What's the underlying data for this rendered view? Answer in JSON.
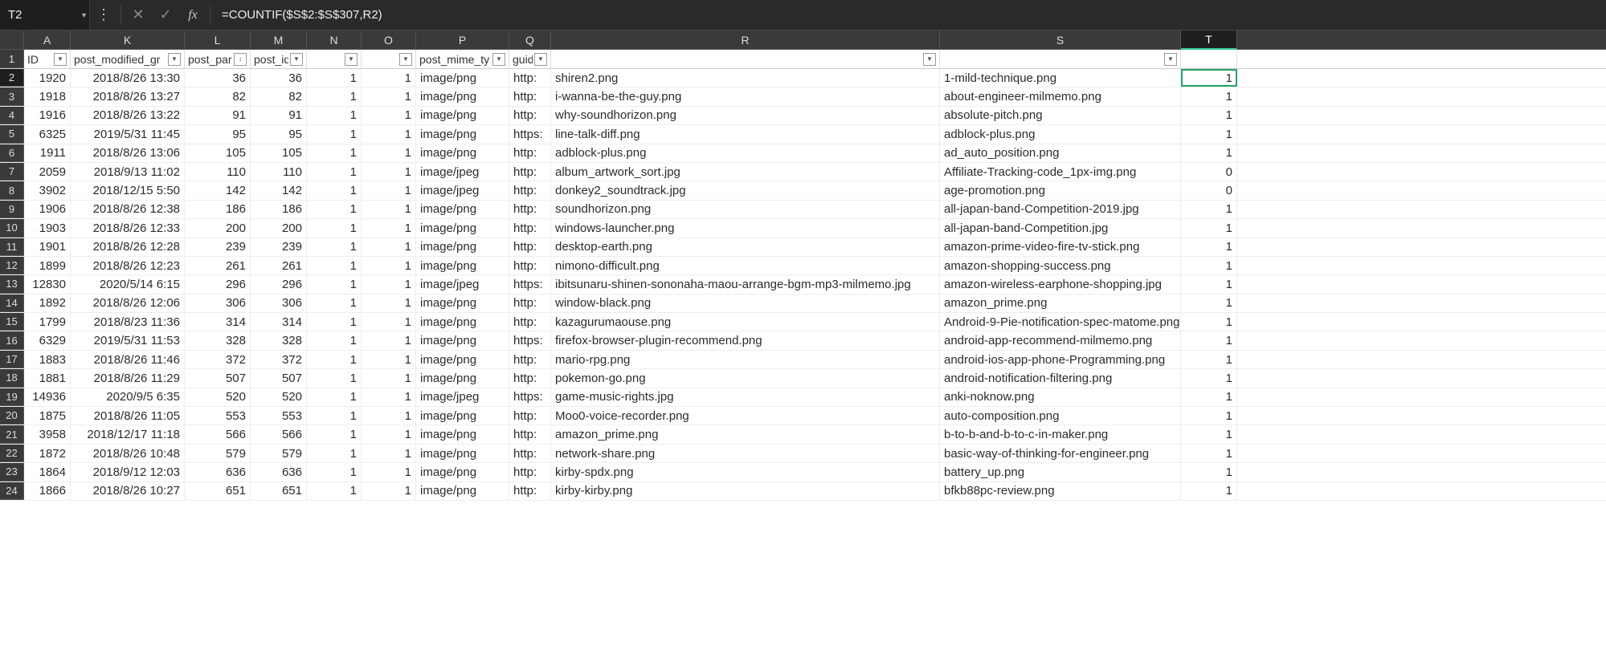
{
  "formula_bar": {
    "cell_ref": "T2",
    "formula": "=COUNTIF($S$2:$S$307,R2)"
  },
  "columns": [
    {
      "letter": "A",
      "width": "cA",
      "header": "ID",
      "filter": "dd"
    },
    {
      "letter": "K",
      "width": "cK",
      "header": "post_modified_gr",
      "filter": "dd"
    },
    {
      "letter": "L",
      "width": "cL",
      "header": "post_pare",
      "filter": "sort"
    },
    {
      "letter": "M",
      "width": "cM",
      "header": "post_id",
      "filter": "dd"
    },
    {
      "letter": "N",
      "width": "cN",
      "header": "",
      "filter": "dd"
    },
    {
      "letter": "O",
      "width": "cO",
      "header": "",
      "filter": "dd"
    },
    {
      "letter": "P",
      "width": "cP",
      "header": "post_mime_ty",
      "filter": "dd"
    },
    {
      "letter": "Q",
      "width": "cQ",
      "header": "guid",
      "filter": "dd"
    },
    {
      "letter": "R",
      "width": "cR",
      "header": "",
      "filter": "dd"
    },
    {
      "letter": "S",
      "width": "cS",
      "header": "",
      "filter": "dd"
    },
    {
      "letter": "T",
      "width": "cT",
      "header": "",
      "filter": null,
      "active": true
    }
  ],
  "rows": [
    {
      "n": 2,
      "A": 1920,
      "K": "2018/8/26 13:30",
      "L": 36,
      "M": 36,
      "N": 1,
      "O": 1,
      "P": "image/png",
      "Q": "http:",
      "R": "shiren2.png",
      "S": "1-mild-technique.png",
      "T": 1,
      "selected": true
    },
    {
      "n": 3,
      "A": 1918,
      "K": "2018/8/26 13:27",
      "L": 82,
      "M": 82,
      "N": 1,
      "O": 1,
      "P": "image/png",
      "Q": "http:",
      "R": "i-wanna-be-the-guy.png",
      "S": "about-engineer-milmemo.png",
      "T": 1
    },
    {
      "n": 4,
      "A": 1916,
      "K": "2018/8/26 13:22",
      "L": 91,
      "M": 91,
      "N": 1,
      "O": 1,
      "P": "image/png",
      "Q": "http:",
      "R": "why-soundhorizon.png",
      "S": "absolute-pitch.png",
      "T": 1
    },
    {
      "n": 5,
      "A": 6325,
      "K": "2019/5/31 11:45",
      "L": 95,
      "M": 95,
      "N": 1,
      "O": 1,
      "P": "image/png",
      "Q": "https:",
      "R": "line-talk-diff.png",
      "S": "adblock-plus.png",
      "T": 1
    },
    {
      "n": 6,
      "A": 1911,
      "K": "2018/8/26 13:06",
      "L": 105,
      "M": 105,
      "N": 1,
      "O": 1,
      "P": "image/png",
      "Q": "http:",
      "R": "adblock-plus.png",
      "S": "ad_auto_position.png",
      "T": 1
    },
    {
      "n": 7,
      "A": 2059,
      "K": "2018/9/13 11:02",
      "L": 110,
      "M": 110,
      "N": 1,
      "O": 1,
      "P": "image/jpeg",
      "Q": "http:",
      "R": "album_artwork_sort.jpg",
      "S": "Affiliate-Tracking-code_1px-img.png",
      "T": 0
    },
    {
      "n": 8,
      "A": 3902,
      "K": "2018/12/15 5:50",
      "L": 142,
      "M": 142,
      "N": 1,
      "O": 1,
      "P": "image/jpeg",
      "Q": "http:",
      "R": "donkey2_soundtrack.jpg",
      "S": "age-promotion.png",
      "T": 0
    },
    {
      "n": 9,
      "A": 1906,
      "K": "2018/8/26 12:38",
      "L": 186,
      "M": 186,
      "N": 1,
      "O": 1,
      "P": "image/png",
      "Q": "http:",
      "R": "soundhorizon.png",
      "S": "all-japan-band-Competition-2019.jpg",
      "T": 1
    },
    {
      "n": 10,
      "A": 1903,
      "K": "2018/8/26 12:33",
      "L": 200,
      "M": 200,
      "N": 1,
      "O": 1,
      "P": "image/png",
      "Q": "http:",
      "R": "windows-launcher.png",
      "S": "all-japan-band-Competition.jpg",
      "T": 1
    },
    {
      "n": 11,
      "A": 1901,
      "K": "2018/8/26 12:28",
      "L": 239,
      "M": 239,
      "N": 1,
      "O": 1,
      "P": "image/png",
      "Q": "http:",
      "R": "desktop-earth.png",
      "S": "amazon-prime-video-fire-tv-stick.png",
      "T": 1
    },
    {
      "n": 12,
      "A": 1899,
      "K": "2018/8/26 12:23",
      "L": 261,
      "M": 261,
      "N": 1,
      "O": 1,
      "P": "image/png",
      "Q": "http:",
      "R": "nimono-difficult.png",
      "S": "amazon-shopping-success.png",
      "T": 1
    },
    {
      "n": 13,
      "A": 12830,
      "K": "2020/5/14 6:15",
      "L": 296,
      "M": 296,
      "N": 1,
      "O": 1,
      "P": "image/jpeg",
      "Q": "https:",
      "R": "ibitsunaru-shinen-sononaha-maou-arrange-bgm-mp3-milmemo.jpg",
      "S": "amazon-wireless-earphone-shopping.jpg",
      "T": 1
    },
    {
      "n": 14,
      "A": 1892,
      "K": "2018/8/26 12:06",
      "L": 306,
      "M": 306,
      "N": 1,
      "O": 1,
      "P": "image/png",
      "Q": "http:",
      "R": "window-black.png",
      "S": "amazon_prime.png",
      "T": 1
    },
    {
      "n": 15,
      "A": 1799,
      "K": "2018/8/23 11:36",
      "L": 314,
      "M": 314,
      "N": 1,
      "O": 1,
      "P": "image/png",
      "Q": "http:",
      "R": "kazagurumaouse.png",
      "S": "Android-9-Pie-notification-spec-matome.png",
      "T": 1
    },
    {
      "n": 16,
      "A": 6329,
      "K": "2019/5/31 11:53",
      "L": 328,
      "M": 328,
      "N": 1,
      "O": 1,
      "P": "image/png",
      "Q": "https:",
      "R": "firefox-browser-plugin-recommend.png",
      "S": "android-app-recommend-milmemo.png",
      "T": 1
    },
    {
      "n": 17,
      "A": 1883,
      "K": "2018/8/26 11:46",
      "L": 372,
      "M": 372,
      "N": 1,
      "O": 1,
      "P": "image/png",
      "Q": "http:",
      "R": "mario-rpg.png",
      "S": "android-ios-app-phone-Programming.png",
      "T": 1
    },
    {
      "n": 18,
      "A": 1881,
      "K": "2018/8/26 11:29",
      "L": 507,
      "M": 507,
      "N": 1,
      "O": 1,
      "P": "image/png",
      "Q": "http:",
      "R": "pokemon-go.png",
      "S": "android-notification-filtering.png",
      "T": 1
    },
    {
      "n": 19,
      "A": 14936,
      "K": "2020/9/5 6:35",
      "L": 520,
      "M": 520,
      "N": 1,
      "O": 1,
      "P": "image/jpeg",
      "Q": "https:",
      "R": "game-music-rights.jpg",
      "S": "anki-noknow.png",
      "T": 1
    },
    {
      "n": 20,
      "A": 1875,
      "K": "2018/8/26 11:05",
      "L": 553,
      "M": 553,
      "N": 1,
      "O": 1,
      "P": "image/png",
      "Q": "http:",
      "R": "Moo0-voice-recorder.png",
      "S": "auto-composition.png",
      "T": 1
    },
    {
      "n": 21,
      "A": 3958,
      "K": "2018/12/17 11:18",
      "L": 566,
      "M": 566,
      "N": 1,
      "O": 1,
      "P": "image/png",
      "Q": "http:",
      "R": "amazon_prime.png",
      "S": "b-to-b-and-b-to-c-in-maker.png",
      "T": 1
    },
    {
      "n": 22,
      "A": 1872,
      "K": "2018/8/26 10:48",
      "L": 579,
      "M": 579,
      "N": 1,
      "O": 1,
      "P": "image/png",
      "Q": "http:",
      "R": "network-share.png",
      "S": "basic-way-of-thinking-for-engineer.png",
      "T": 1
    },
    {
      "n": 23,
      "A": 1864,
      "K": "2018/9/12 12:03",
      "L": 636,
      "M": 636,
      "N": 1,
      "O": 1,
      "P": "image/png",
      "Q": "http:",
      "R": "kirby-spdx.png",
      "S": "battery_up.png",
      "T": 1
    },
    {
      "n": 24,
      "A": 1866,
      "K": "2018/8/26 10:27",
      "L": 651,
      "M": 651,
      "N": 1,
      "O": 1,
      "P": "image/png",
      "Q": "http:",
      "R": "kirby-kirby.png",
      "S": "bfkb88pc-review.png",
      "T": 1
    }
  ]
}
